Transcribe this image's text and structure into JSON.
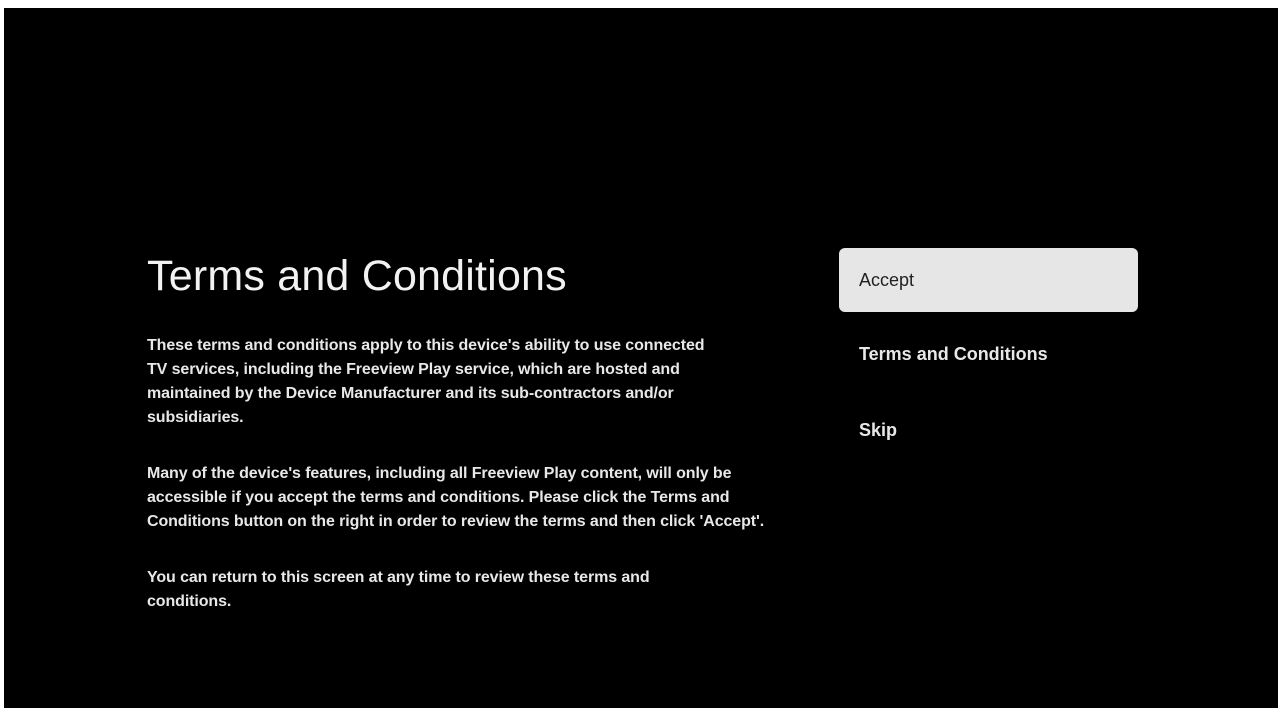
{
  "page": {
    "title": "Terms and Conditions",
    "paragraphs": [
      "These terms and conditions apply to this device's ability to use connected TV services, including the Freeview Play service, which are hosted and maintained by the Device Manufacturer and its sub-contractors and/or subsidiaries.",
      "Many of the device's features, including all Freeview Play content, will only be accessible if you accept the terms and conditions. Please click the Terms and Conditions button on the right in order to review the terms and then click 'Accept'.",
      "You can return to this screen at any time to review these terms and conditions."
    ]
  },
  "menu": {
    "items": [
      {
        "label": "Accept",
        "focused": true
      },
      {
        "label": "Terms and Conditions",
        "focused": false
      },
      {
        "label": "Skip",
        "focused": false
      }
    ]
  },
  "colors": {
    "background": "#000000",
    "focus_bg": "#e6e6e6",
    "text": "#ffffff"
  }
}
